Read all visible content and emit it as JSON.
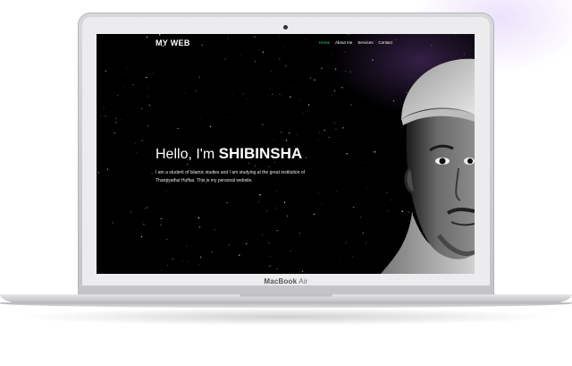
{
  "device": {
    "label_bold": "MacBook",
    "label_regular": " Air"
  },
  "site": {
    "brand": "MY WEB",
    "nav": [
      {
        "label": "Home",
        "active": true
      },
      {
        "label": "About me",
        "active": false
      },
      {
        "label": "Services",
        "active": false
      },
      {
        "label": "Contact",
        "active": false
      }
    ],
    "hero": {
      "greeting": "Hello, I'm ",
      "name": "SHIBINSHA",
      "description_line1": "I am a student of Islamic studies and I am studying at the great institution of",
      "description_line2": "Tharqiyathul Huffas. This is my personal website."
    },
    "colors": {
      "background": "#000000",
      "text": "#ffffff",
      "nav_active": "#3cd070"
    }
  }
}
